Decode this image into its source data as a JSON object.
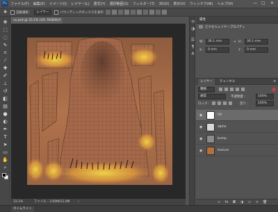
{
  "menubar": {
    "logo": "Ps",
    "items": [
      "ファイル(F)",
      "編集(E)",
      "イメージ(I)",
      "レイヤー(L)",
      "書式(Y)",
      "選択範囲(S)",
      "フィルター(T)",
      "3D(D)",
      "表示(V)",
      "ウィンドウ(W)",
      "ヘルプ(H)"
    ],
    "window_controls": [
      "—",
      "▢",
      "✕"
    ]
  },
  "options_bar": {
    "auto_select_label": "自動選択：",
    "auto_select_target": "レイヤー",
    "transform_label": "バウンディングボックスを表示"
  },
  "document": {
    "tab_title": "uv.psd @ 33.1% (UV, RGB/8) *",
    "close_glyph": "×"
  },
  "status": {
    "zoom": "33.1%",
    "file_info": "ファイル : 3.00M/12.0M",
    "arrow": "›"
  },
  "timeline": {
    "label": "タイムライン"
  },
  "properties": {
    "header": "属性",
    "title": "ピクセルレイヤープロパティ",
    "w_label": "W :",
    "w_value": "36.1 mm",
    "h_label": "H :",
    "h_value": "36.1 mm",
    "x_label": "X :",
    "x_value": "0 mm",
    "y_label": "Y :",
    "y_value": "0 mm"
  },
  "layers_panel": {
    "tab_layers": "レイヤー",
    "tab_channels": "チャンネル",
    "menu_glyph": "≡",
    "kind": "種類",
    "blend_mode": "通常",
    "opacity_label": "不透明度 :",
    "opacity_value": "100%",
    "lock_label": "ロック :",
    "fill_label": "塗り :",
    "fill_value": "100%",
    "layers": [
      {
        "name": "UV",
        "thumb_color": "#ffffff",
        "selected": true
      },
      {
        "name": "alpha",
        "thumb_color": "#d8d8d8",
        "selected": false
      },
      {
        "name": "bump",
        "thumb_color": "#8c8c8c",
        "selected": false
      },
      {
        "name": "texture",
        "thumb_color": "#b4703f",
        "selected": false
      }
    ]
  },
  "icons": {
    "tools": [
      "move-icon",
      "marquee-icon",
      "lasso-icon",
      "quick-select-icon",
      "crop-icon",
      "eyedropper-icon",
      "healing-icon",
      "brush-icon",
      "stamp-icon",
      "history-brush-icon",
      "eraser-icon",
      "gradient-icon",
      "blur-icon",
      "dodge-icon",
      "pen-icon",
      "type-icon",
      "path-select-icon",
      "shape-icon",
      "hand-icon",
      "zoom-icon"
    ],
    "right_dock": [
      "history-icon",
      "adjustments-icon",
      "properties-icon",
      "paragraph-icon",
      "character-icon"
    ]
  },
  "colors": {
    "ui_bg": "#535353",
    "canvas_bg": "#282828",
    "doc_base": "#a06845",
    "glow": "#f0d23c",
    "wire": "#5a3624"
  }
}
